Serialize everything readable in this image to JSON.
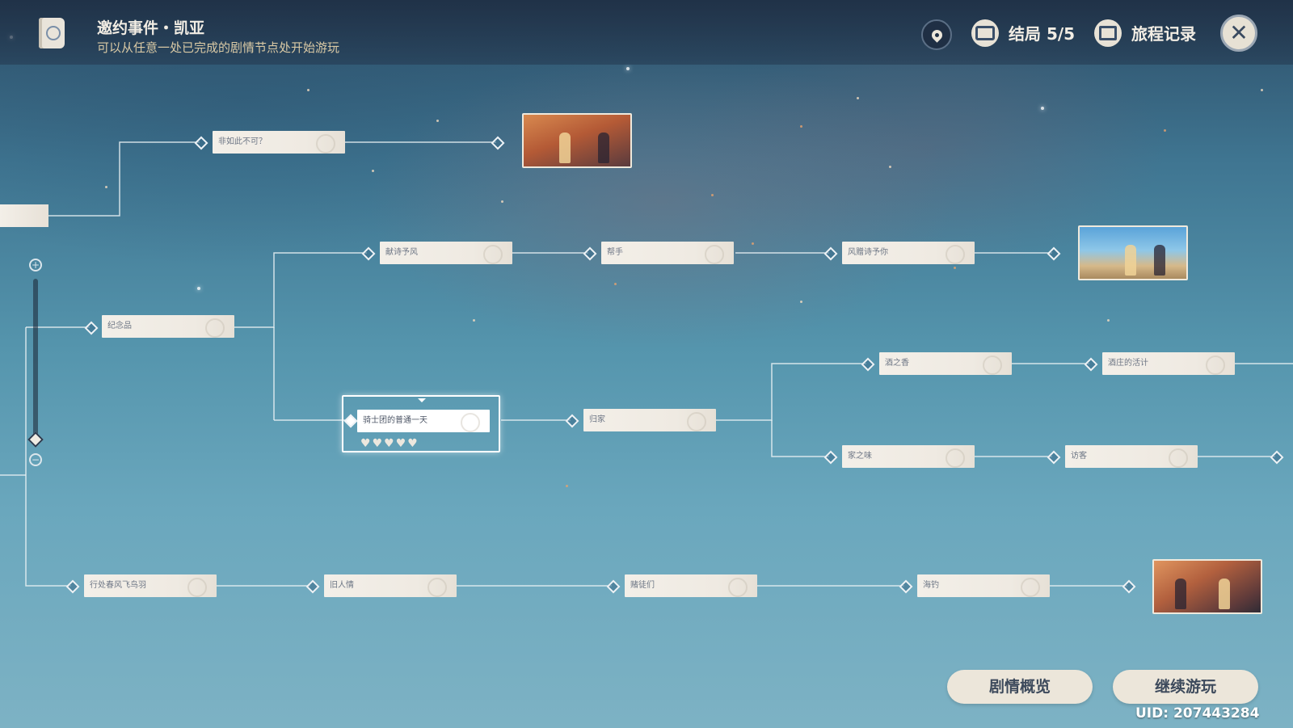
{
  "header": {
    "title": "邀约事件・凯亚",
    "subtitle": "可以从任意一处已完成的剧情节点处开始游玩",
    "endings_label": "结局 5/5",
    "journey_label": "旅程记录",
    "close_glyph": "✕",
    "icons": [
      "book-icon",
      "location-pin-icon",
      "endings-icon",
      "photo-icon",
      "close-icon"
    ]
  },
  "graph": {
    "nodes": [
      "非如此不可？",
      "献诗予风",
      "帮手",
      "风赠诗予你",
      "纪念品",
      "骑士团的普通一天",
      "归家",
      "酒之香",
      "酒庄的活计",
      "家之味",
      "访客",
      "行处春风飞鸟羽",
      "旧人情",
      "赌徒们",
      "海钓"
    ],
    "selected_node": "骑士团的普通一天",
    "selected_hearts": 5,
    "endings": [
      "ending-sunset",
      "ending-beach",
      "ending-rock"
    ]
  },
  "zoom": {
    "plus_glyph": "+",
    "minus_glyph": "−",
    "level": 0.05
  },
  "footer": {
    "overview_button": "剧情概览",
    "continue_button": "继续游玩",
    "uid": "UID: 207443284"
  },
  "colors": {
    "panel": "#f3efe8",
    "accent_text": "#d9c9a5",
    "button": "#ece6da"
  }
}
